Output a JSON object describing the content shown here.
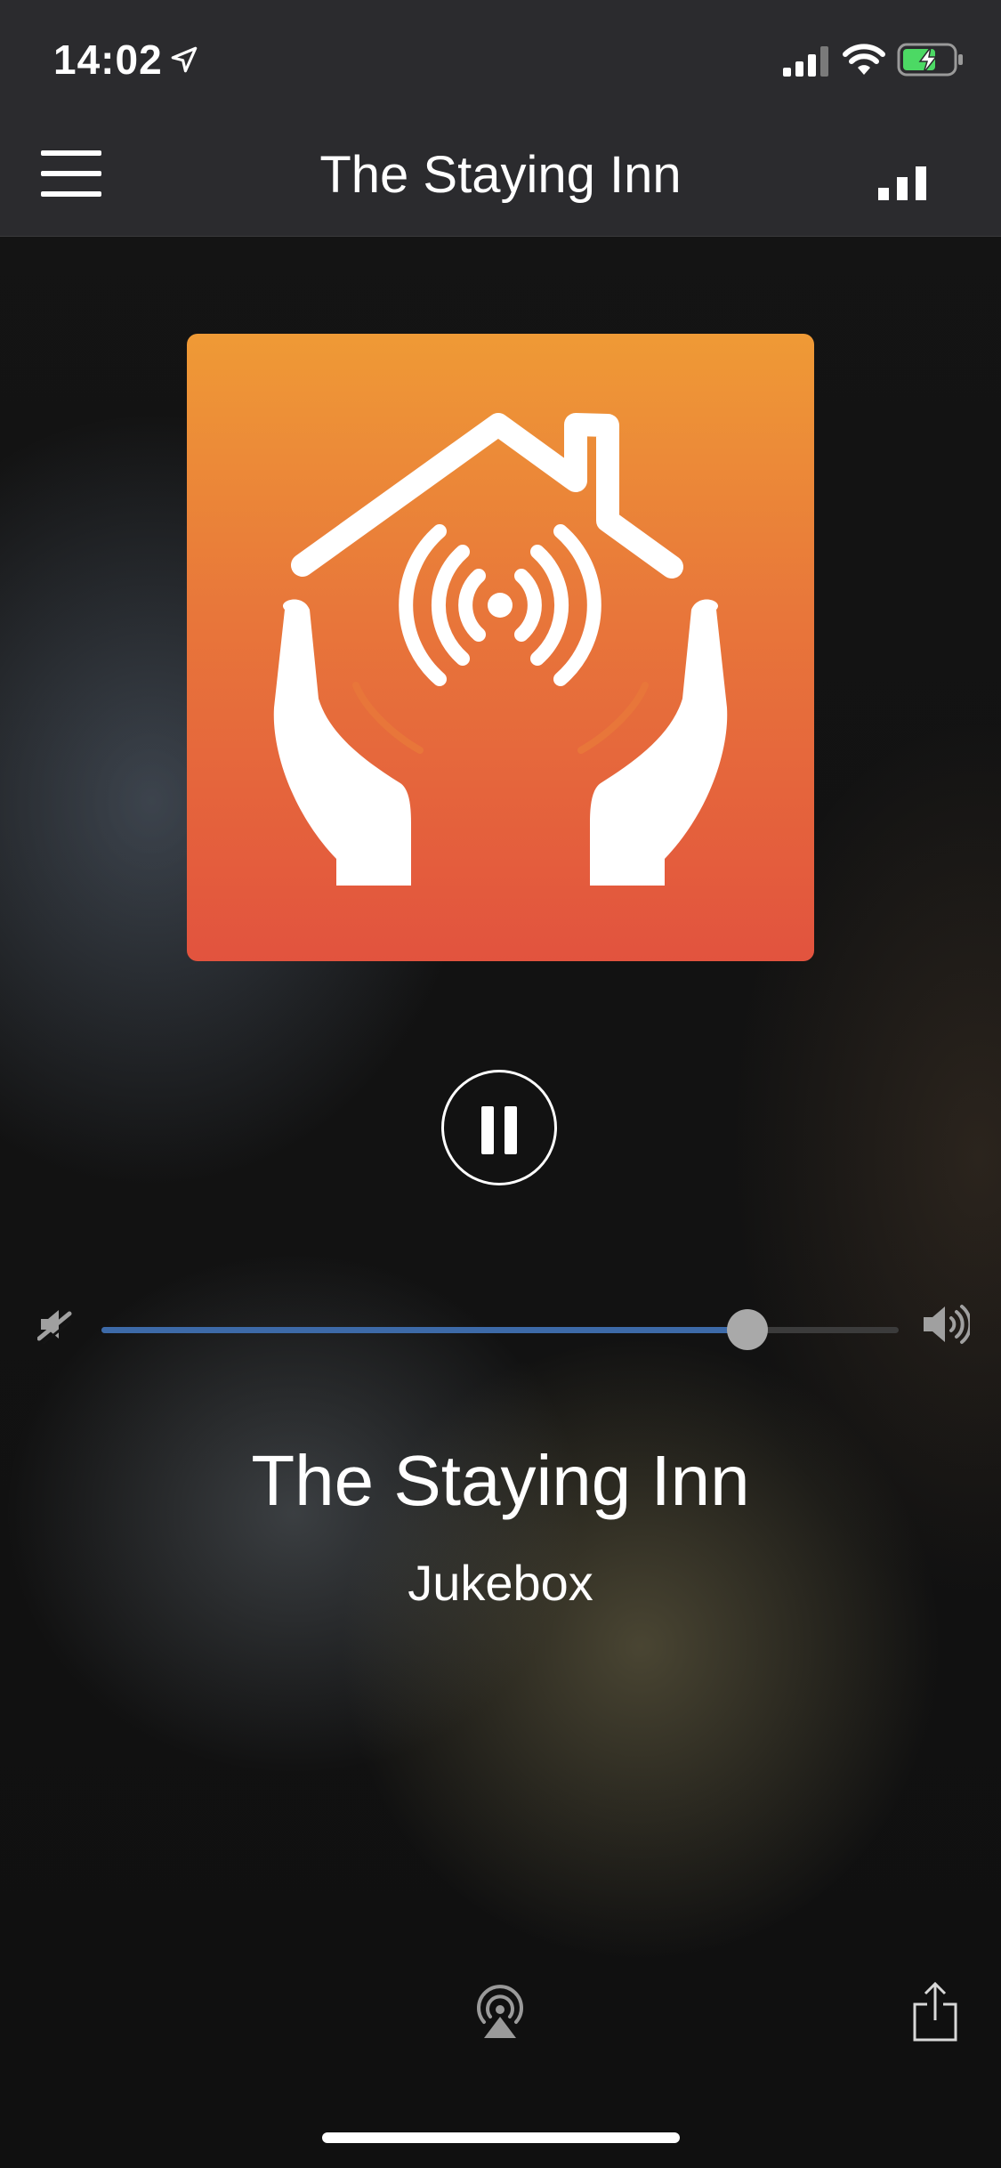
{
  "status_bar": {
    "time": "14:02",
    "icons": [
      "location-arrow-icon",
      "cellular-signal-icon",
      "wifi-icon",
      "battery-charging-icon"
    ],
    "battery_color": "#4cd964"
  },
  "nav": {
    "title": "The Staying Inn",
    "menu_icon": "hamburger-menu-icon",
    "right_icon": "signal-bars-icon"
  },
  "artwork": {
    "icon": "house-hands-broadcast-icon",
    "gradient": [
      "#ef9a36",
      "#e2533e"
    ]
  },
  "player": {
    "state": "playing",
    "control_icon": "pause-icon",
    "volume": 0.81,
    "volume_fill_color": "#3d6aa8"
  },
  "station": {
    "title": "The Staying Inn",
    "subtitle": "Jukebox"
  },
  "bottom_bar": {
    "left_icon": "airplay-icon",
    "right_icon": "share-icon"
  }
}
